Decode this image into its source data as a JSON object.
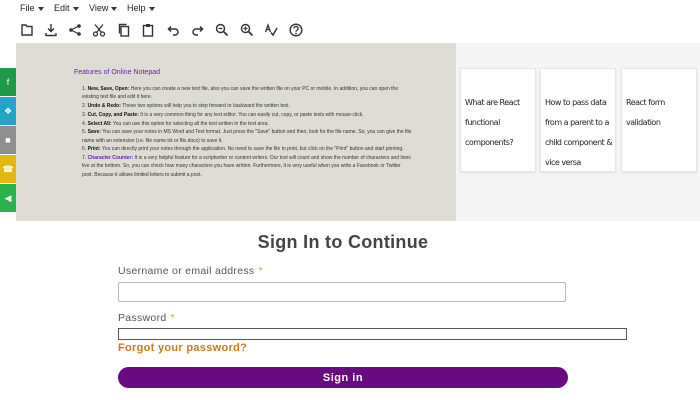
{
  "menu": {
    "items": [
      "File",
      "Edit",
      "View",
      "Help"
    ]
  },
  "toolbar": {
    "icons": [
      "new-file-icon",
      "download-icon",
      "share-icon",
      "cut-icon",
      "copy-icon",
      "paste-icon",
      "undo-icon",
      "redo-icon",
      "zoom-out-icon",
      "zoom-in-icon",
      "spell-check-icon",
      "help-icon"
    ]
  },
  "social": {
    "colors": [
      "#1e9a48",
      "#26a3c8",
      "#8f8f8f",
      "#e3b812",
      "#2bb34a"
    ]
  },
  "editor": {
    "title": "Features of Online Notepad",
    "features": [
      {
        "label": "New, Save, Open:",
        "text": " Here you can create a new text file, also you can save the written file on your PC or mobile. In addition, you can open the existing text file and edit it here."
      },
      {
        "label": "Undo & Redo:",
        "text": " These two options will help you to step forward or backward the written text."
      },
      {
        "label": "Cut, Copy, and Paste:",
        "text": " It is a very common thing for any text editor. You can easily cut, copy, or paste texts with mouse-click."
      },
      {
        "label": "Select All:",
        "text": " You can use this option for selecting all the text written in the text area."
      },
      {
        "label": "Save:",
        "text": " You can save your notes in MS Word and Text format. Just press the \"Save\" button and then, look for the file name. So, you can give the file name with an extension (i.e. file name.txt or file.docx) to save it."
      },
      {
        "label": "Print:",
        "text": " You can directly print your notes through the application. No need to save the file to print, but click on the \"Print\" button and start printing."
      },
      {
        "label": "Character Counter:",
        "text": " It is a very helpful feature for a scriptwriter or content writers. Our tool will count and show the number of characters and lines live at the bottom. So, you can check how many characters you have written. Furthermore, it is very useful when you write a Facebook or Twitter post. Because it allows limited letters to submit a post."
      }
    ]
  },
  "cards": [
    {
      "text": "What are React functional components?"
    },
    {
      "text": "How to pass data from a parent to a child component & vice versa"
    },
    {
      "text": "React form validation"
    }
  ],
  "signin": {
    "title": "Sign In to Continue",
    "username_label": "Username or email address",
    "password_label": "Password",
    "required_mark": "*",
    "username_value": "",
    "password_value": "",
    "forgot_link": "Forgot your password?",
    "button_label": "Sign in"
  }
}
